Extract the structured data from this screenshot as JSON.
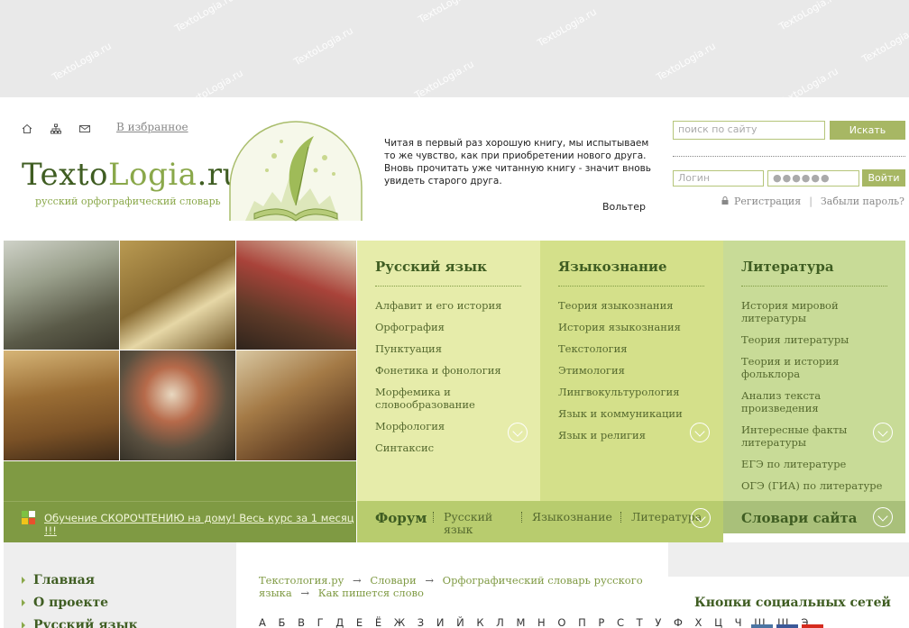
{
  "banner": {
    "watermark": "TextoLogia.ru"
  },
  "header": {
    "favorites_label": "В избранное",
    "logo_part1": "Texto",
    "logo_part2": "Logia",
    "logo_part3": ".ru",
    "tagline": "русский орфографический словарь",
    "quote": "Читая в первый раз хорошую книгу, мы испытываем то же чувство, как при приобретении нового друга. Вновь прочитать уже читанную книгу - значит вновь увидеть старого друга.",
    "quote_author": "Вольтер"
  },
  "search": {
    "placeholder": "поиск по сайту",
    "button_label": "Искать"
  },
  "login": {
    "login_placeholder": "Логин",
    "password_placeholder": "●●●●●●",
    "button_label": "Войти",
    "register_label": "Регистрация",
    "forgot_label": "Забыли пароль?"
  },
  "promo": {
    "text": "Обучение СКОРОЧТЕНИЮ на дому! Весь курс за 1 месяц !!!"
  },
  "columns": [
    {
      "title": "Русский язык",
      "items": [
        "Алфавит и его история",
        "Орфография",
        "Пунктуация",
        "Фонетика и фонология",
        "Морфемика и словообразование",
        "Морфология",
        "Синтаксис"
      ]
    },
    {
      "title": "Языкознание",
      "items": [
        "Теория языкознания",
        "История языкознания",
        "Текстология",
        "Этимология",
        "Лингвокультурология",
        "Язык и коммуникации",
        "Язык и религия"
      ]
    },
    {
      "title": "Литература",
      "items": [
        "История мировой литературы",
        "Теория литературы",
        "Теория и история фольклора",
        "Анализ текста произведения",
        "Интересные факты литературы",
        "ЕГЭ по литературе",
        "ОГЭ (ГИА) по литературе"
      ]
    }
  ],
  "forum_bar": {
    "title": "Форум",
    "links": [
      "Русский язык",
      "Языкознание",
      "Литература"
    ]
  },
  "dictionaries_bar": {
    "title": "Словари сайта"
  },
  "left_nav": {
    "items": [
      "Главная",
      "О проекте",
      "Русский язык"
    ]
  },
  "breadcrumbs": {
    "home": "Текстология.ру",
    "dictionaries": "Словари",
    "dictionary": "Орфографический словарь русского языка",
    "current": "Как пишется слово",
    "separator": "→"
  },
  "alphabet": "А Б В Г Д Е Ё Ж З И Й К Л М Н О П Р С Т У Ф Х Ц Ч Ш Щ Э",
  "social": {
    "title": "Кнопки социальных сетей"
  },
  "colors": {
    "brand_dark": "#3f5d22",
    "brand_light": "#8aa84a",
    "column1_bg": "#e6ecaa",
    "column2_bg": "#d4e08a",
    "column3_bg": "#c8db97",
    "olive": "#7f9a43"
  }
}
